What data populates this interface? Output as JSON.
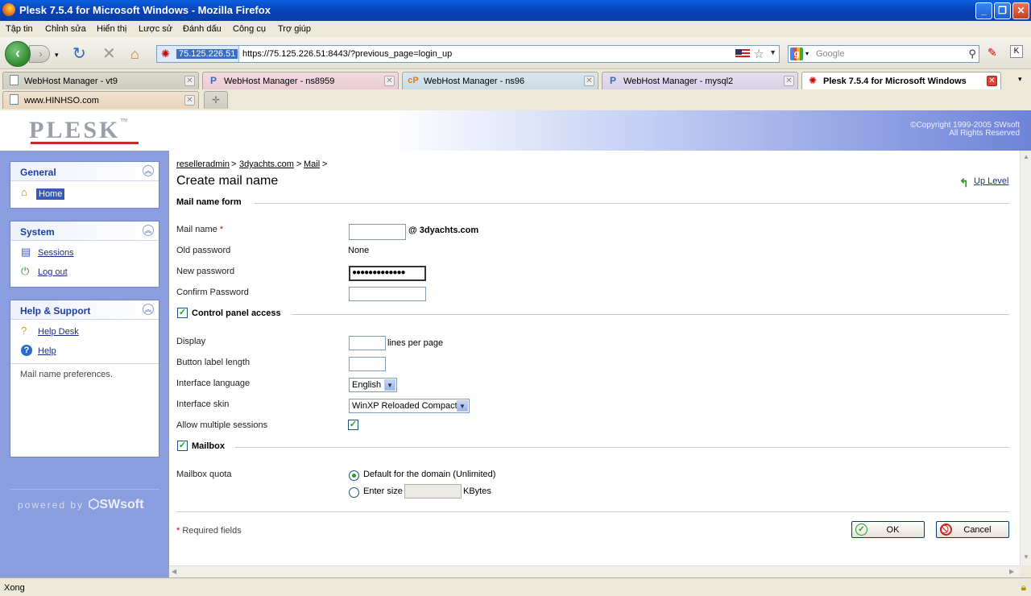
{
  "window": {
    "title": "Plesk 7.5.4 for Microsoft Windows - Mozilla Firefox"
  },
  "menu": [
    "Tập tin",
    "Chỉnh sửa",
    "Hiển thị",
    "Lược sử",
    "Đánh dấu",
    "Công cụ",
    "Trợ giúp"
  ],
  "navbar": {
    "site_identity": "75.125.226.51",
    "url": "https://75.125.226.51:8443/?previous_page=login_up",
    "search_placeholder": "Google"
  },
  "tabs": [
    {
      "label": "WebHost Manager - vt9",
      "icon": "page-icon"
    },
    {
      "label": "WebHost Manager - ns8959",
      "icon": "cpanel-icon"
    },
    {
      "label": "WebHost Manager - ns96",
      "icon": "cpanel-icon"
    },
    {
      "label": "WebHost Manager - mysql2",
      "icon": "cpanel-icon"
    },
    {
      "label": "Plesk 7.5.4 for Microsoft Windows",
      "icon": "plesk-icon",
      "active": true
    },
    {
      "label": "www.HINHSO.com",
      "icon": "page-icon"
    }
  ],
  "header": {
    "logo": "PLESK",
    "logo_tm": "™",
    "copyright_line1": "©Copyright 1999-2005 SWsoft",
    "copyright_line2": "All Rights Reserved"
  },
  "sidebar": {
    "general": {
      "title": "General",
      "items": [
        {
          "label": "Home",
          "icon": "home-icon"
        }
      ]
    },
    "system": {
      "title": "System",
      "items": [
        {
          "label": "Sessions",
          "icon": "sessions-icon"
        },
        {
          "label": "Log out",
          "icon": "logout-icon"
        }
      ]
    },
    "help": {
      "title": "Help & Support",
      "items": [
        {
          "label": "Help Desk",
          "icon": "helpdesk-icon"
        },
        {
          "label": "Help",
          "icon": "help-icon"
        }
      ],
      "description": "Mail name preferences."
    },
    "powered_by": "powered by",
    "powered_brand": "SWsoft"
  },
  "breadcrumb": {
    "items": [
      "reselleradmin",
      "3dyachts.com",
      "Mail"
    ],
    "separator": ">"
  },
  "page": {
    "title": "Create mail name",
    "up_level": "Up Level"
  },
  "form": {
    "section_mail": "Mail name form",
    "mail_name_label": "Mail name",
    "required_marker": "*",
    "domain_suffix": "@ 3dyachts.com",
    "old_password_label": "Old password",
    "old_password_value": "None",
    "new_password_label": "New password",
    "new_password_mask": "●●●●●●●●●●●●●",
    "confirm_password_label": "Confirm Password",
    "section_cp": "Control panel access",
    "display_label": "Display",
    "lines_per_page": "lines per page",
    "button_label_length": "Button label length",
    "interface_language_label": "Interface language",
    "interface_language_value": "English",
    "interface_skin_label": "Interface skin",
    "interface_skin_value": "WinXP Reloaded Compact",
    "allow_multiple_sessions_label": "Allow multiple sessions",
    "section_mailbox": "Mailbox",
    "mailbox_quota_label": "Mailbox quota",
    "quota_default": "Default for the domain (Unlimited)",
    "quota_enter_size": "Enter size",
    "quota_unit": "KBytes",
    "required_note": "Required fields",
    "ok_label": "OK",
    "cancel_label": "Cancel"
  },
  "status": {
    "text": "Xong"
  }
}
